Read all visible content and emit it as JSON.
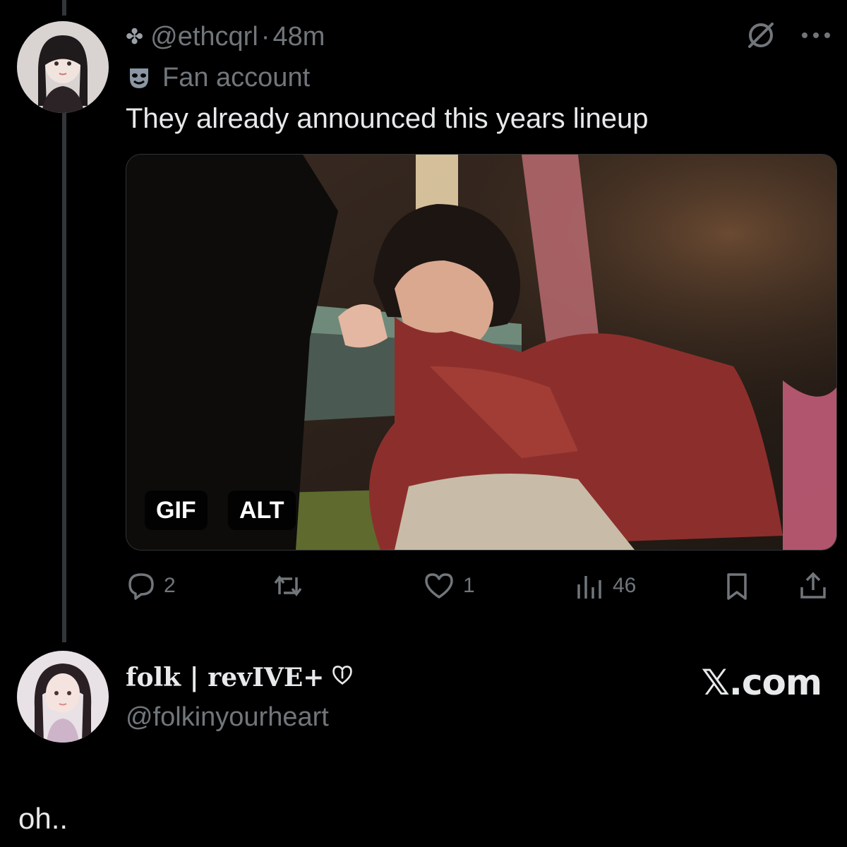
{
  "tweet": {
    "handle": "@ethcqrl",
    "separator": "·",
    "time": "48m",
    "label": "Fan account",
    "text": "They already announced this years lineup",
    "media": {
      "badge_gif": "GIF",
      "badge_alt": "ALT"
    },
    "actions": {
      "reply_count": "2",
      "repost_count": "",
      "like_count": "1",
      "views_count": "46"
    }
  },
  "reply": {
    "display_name": "folk | revIVE+",
    "handle": "@folkinyourheart",
    "brand": "𝕏.com",
    "text": "oh.."
  },
  "colors": {
    "background": "#000000",
    "primary_text": "#e7e9ea",
    "secondary_text": "#71767b",
    "thread_line": "#333639"
  },
  "icons": [
    "club-icon",
    "mask-icon",
    "grok-icon",
    "more-icon",
    "reply-icon",
    "repost-icon",
    "like-icon",
    "views-icon",
    "bookmark-icon",
    "share-icon",
    "heart-shield-icon"
  ]
}
